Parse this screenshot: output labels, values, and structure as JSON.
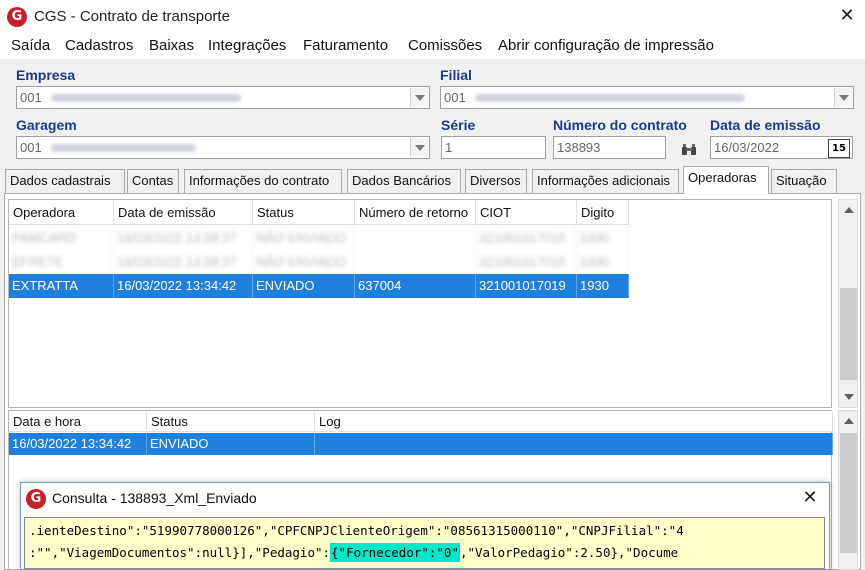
{
  "window": {
    "title": "CGS - Contrato de transporte",
    "logo_letter": "G",
    "close_glyph": "✕"
  },
  "menu": [
    "Saída",
    "Cadastros",
    "Baixas",
    "Integrações",
    "Faturamento",
    "Comissões",
    "Abrir configuração de impressão"
  ],
  "form": {
    "empresa": {
      "label": "Empresa",
      "value": "001"
    },
    "filial": {
      "label": "Filial",
      "value": "001"
    },
    "garagem": {
      "label": "Garagem",
      "value": "001"
    },
    "serie": {
      "label": "Série",
      "value": "1"
    },
    "numero_contrato": {
      "label": "Número do contrato",
      "value": "138893"
    },
    "data_emissao": {
      "label": "Data de emissão",
      "value": "16/03/2022",
      "calendar_glyph": "15"
    }
  },
  "tabs": [
    "Dados cadastrais",
    "Contas",
    "Informações do contrato",
    "Dados Bancários",
    "Diversos",
    "Informações adicionais",
    "Operadoras",
    "Situação"
  ],
  "active_tab": "Operadoras",
  "operadoras_grid": {
    "columns": [
      "Operadora",
      "Data de emissão",
      "Status",
      "Número de retorno",
      "CIOT",
      "Digito"
    ],
    "rows": [
      {
        "operadora": "PAMCARD",
        "data": "16/03/2022 13:28:37",
        "status": "NÃO ENVIADO",
        "retorno": "",
        "ciot": "321001017015",
        "digito": "1930",
        "state": "blurred"
      },
      {
        "operadora": "EFRETE",
        "data": "16/03/2022 13:28:37",
        "status": "NÃO ENVIADO",
        "retorno": "",
        "ciot": "321001017015",
        "digito": "1930",
        "state": "blurred"
      },
      {
        "operadora": "EXTRATTA",
        "data": "16/03/2022 13:34:42",
        "status": "ENVIADO",
        "retorno": "637004",
        "ciot": "321001017019",
        "digito": "1930",
        "state": "selected"
      }
    ]
  },
  "log_grid": {
    "columns": [
      "Data e hora",
      "Status",
      "Log"
    ],
    "rows": [
      {
        "data_hora": "16/03/2022 13:34:42",
        "status": "ENVIADO",
        "log": ""
      }
    ]
  },
  "dialog": {
    "title": "Consulta - 138893_Xml_Enviado",
    "logo_letter": "G",
    "close_glyph": "✕",
    "line1": ".ienteDestino\":\"51990778000126\",\"CPFCNPJClienteOrigem\":\"08561315000110\",\"CNPJFilial\":\"4",
    "line2_pre": ":\"\",\"ViagemDocumentos\":null}],\"Pedagio\":",
    "line2_hl": "{\"Fornecedor\":\"0\"",
    "line2_post": ",\"ValorPedagio\":2.50},\"Docume"
  },
  "colors": {
    "accent_label": "#1a3a8c",
    "selection": "#1f7fdd",
    "highlight": "#00e8c8",
    "code_bg": "#ffffcc",
    "logo": "#c8202a"
  }
}
